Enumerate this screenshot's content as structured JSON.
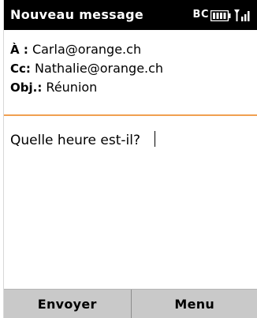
{
  "titlebar": {
    "title": "Nouveau message",
    "bt_label": "BC"
  },
  "fields": {
    "to_label": "À :",
    "to_value": "Carla@orange.ch",
    "cc_label": "Cc:",
    "cc_value": "Nathalie@orange.ch",
    "subject_label": "Obj.:",
    "subject_value": "Réunion"
  },
  "message": {
    "body": "Quelle heure est-il?"
  },
  "softkeys": {
    "left": "Envoyer",
    "right": "Menu"
  },
  "colors": {
    "titlebar_bg": "#000000",
    "divider": "#f0a050",
    "softkey_bg": "#c9c9c9"
  },
  "icons": {
    "bluetooth": "bluetooth-icon",
    "battery": "battery-icon",
    "signal": "signal-icon"
  }
}
